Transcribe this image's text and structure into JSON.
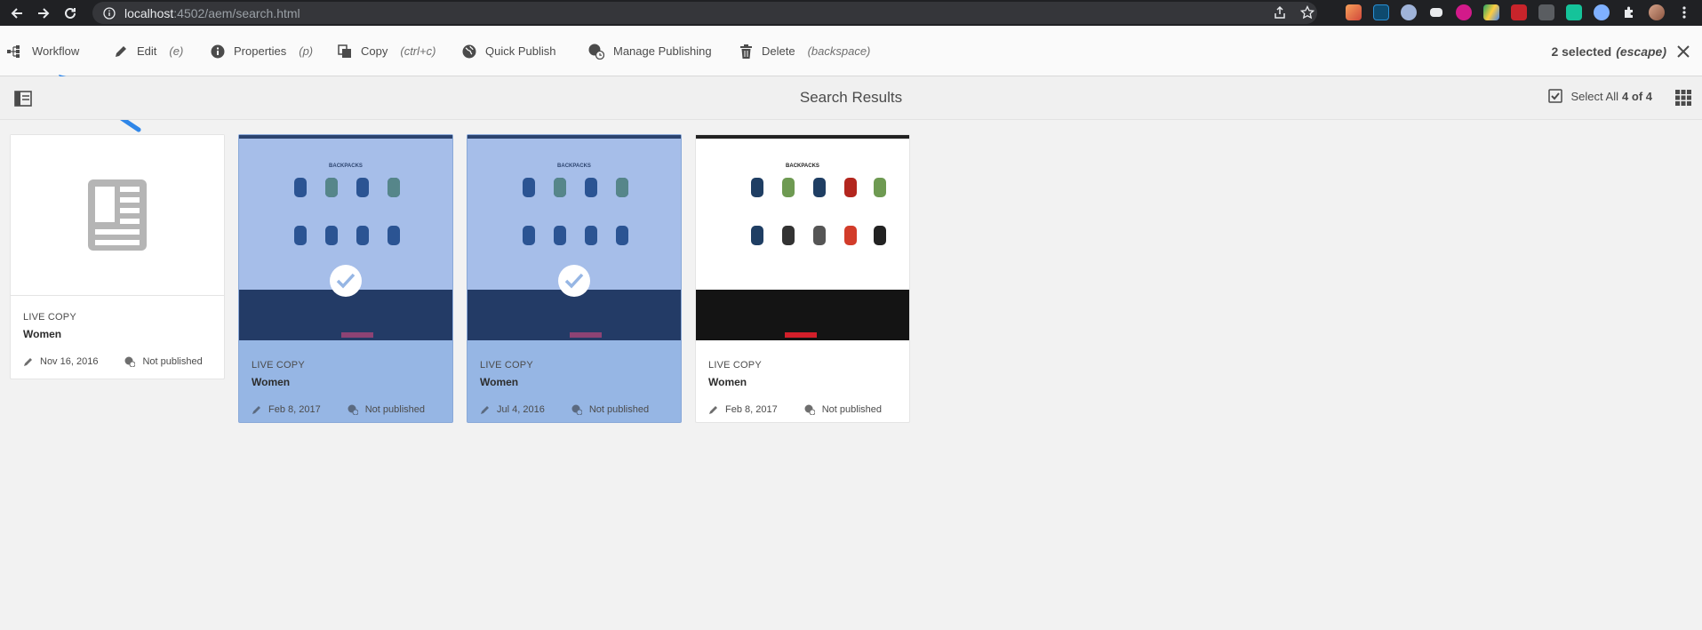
{
  "browser": {
    "url_host": "localhost",
    "url_path": ":4502/aem/search.html"
  },
  "actionbar": {
    "actions": [
      {
        "label": "Workflow",
        "shortcut": ""
      },
      {
        "label": "Edit",
        "shortcut": "(e)"
      },
      {
        "label": "Properties",
        "shortcut": "(p)"
      },
      {
        "label": "Copy",
        "shortcut": "(ctrl+c)"
      },
      {
        "label": "Quick Publish",
        "shortcut": ""
      },
      {
        "label": "Manage Publishing",
        "shortcut": ""
      },
      {
        "label": "Delete",
        "shortcut": "(backspace)"
      }
    ],
    "selected_text": "2 selected",
    "selected_shortcut": "(escape)"
  },
  "titlebar": {
    "title": "Search Results",
    "select_all": "Select All",
    "count": "4 of 4"
  },
  "cards": [
    {
      "type": "LIVE COPY",
      "name": "Women",
      "date": "Nov 16, 2016",
      "status": "Not published",
      "selected": false
    },
    {
      "type": "LIVE COPY",
      "name": "Women",
      "date": "Feb 8, 2017",
      "status": "Not published",
      "selected": true
    },
    {
      "type": "LIVE COPY",
      "name": "Women",
      "date": "Jul 4, 2016",
      "status": "Not published",
      "selected": true
    },
    {
      "type": "LIVE COPY",
      "name": "Women",
      "date": "Feb 8, 2017",
      "status": "Not published",
      "selected": false
    }
  ],
  "thumbnail": {
    "heading": "BACKPACKS"
  },
  "colors": {
    "accent_blue": "#2680eb",
    "selection": "#96b6e4",
    "arrow": "#2f86e8"
  }
}
